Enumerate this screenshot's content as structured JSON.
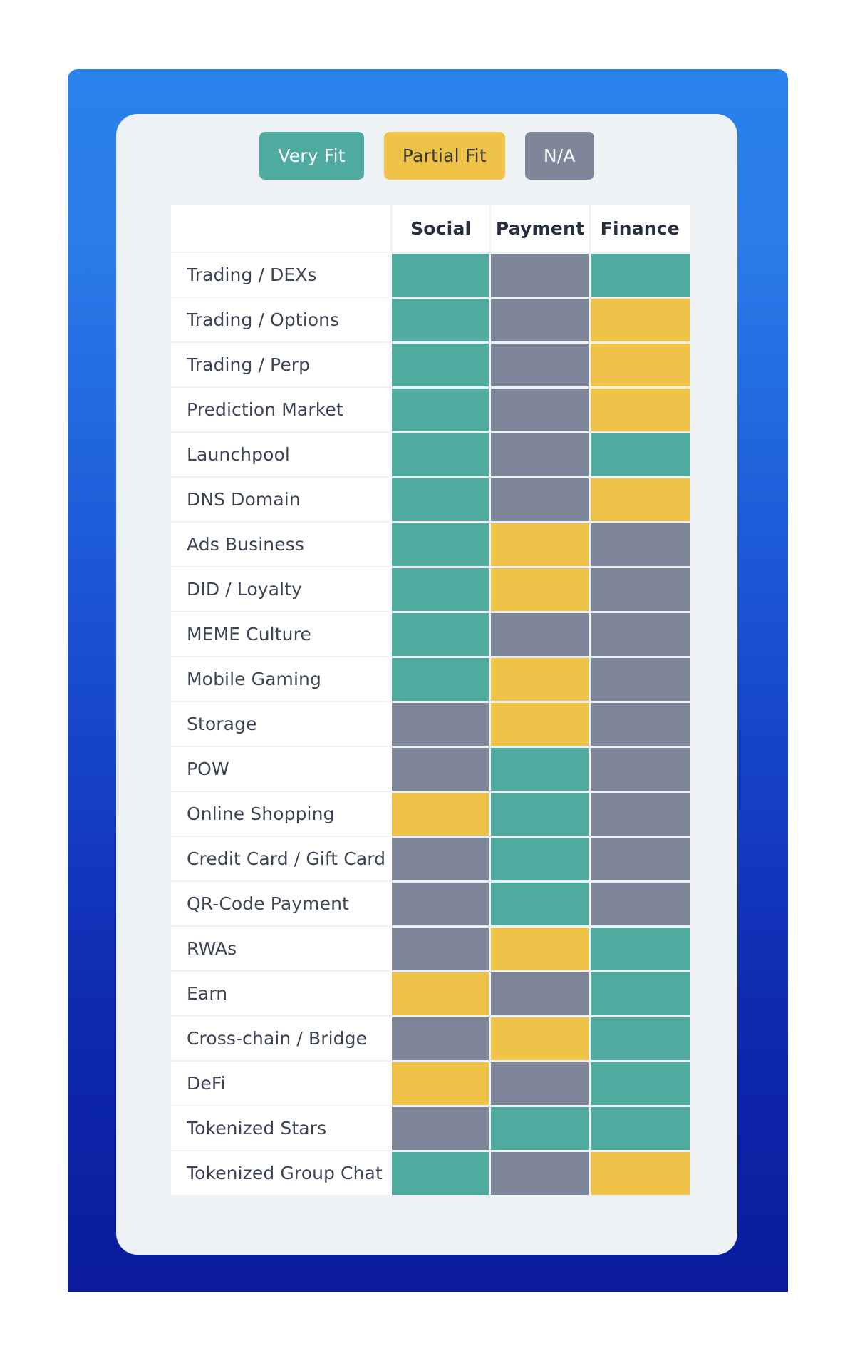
{
  "legend": {
    "items": [
      {
        "label": "Very Fit",
        "key": "very",
        "color": "#4fab9f"
      },
      {
        "label": "Partial Fit",
        "key": "partial",
        "color": "#efc348"
      },
      {
        "label": "N/A",
        "key": "na",
        "color": "#7d8799"
      }
    ]
  },
  "chart_data": {
    "type": "heatmap",
    "title": "",
    "xlabel": "",
    "ylabel": "",
    "legend_position": "top-center",
    "corner_header": "",
    "categories": [
      "Social",
      "Payment",
      "Finance"
    ],
    "row_labels": [
      "Trading / DEXs",
      "Trading / Options",
      "Trading / Perp",
      "Prediction Market",
      "Launchpool",
      "DNS Domain",
      "Ads Business",
      "DID / Loyalty",
      "MEME Culture",
      "Mobile Gaming",
      "Storage",
      "POW",
      "Online Shopping",
      "Credit Card / Gift Card",
      "QR-Code Payment",
      "RWAs",
      "Earn",
      "Cross-chain / Bridge",
      "DeFi",
      "Tokenized Stars",
      "Tokenized Group Chat"
    ],
    "value_levels": {
      "very": "Very Fit",
      "partial": "Partial Fit",
      "na": "N/A"
    },
    "values": [
      [
        "very",
        "na",
        "very"
      ],
      [
        "very",
        "na",
        "partial"
      ],
      [
        "very",
        "na",
        "partial"
      ],
      [
        "very",
        "na",
        "partial"
      ],
      [
        "very",
        "na",
        "very"
      ],
      [
        "very",
        "na",
        "partial"
      ],
      [
        "very",
        "partial",
        "na"
      ],
      [
        "very",
        "partial",
        "na"
      ],
      [
        "very",
        "na",
        "na"
      ],
      [
        "very",
        "partial",
        "na"
      ],
      [
        "na",
        "partial",
        "na"
      ],
      [
        "na",
        "very",
        "na"
      ],
      [
        "partial",
        "very",
        "na"
      ],
      [
        "na",
        "very",
        "na"
      ],
      [
        "na",
        "very",
        "na"
      ],
      [
        "na",
        "partial",
        "very"
      ],
      [
        "partial",
        "na",
        "very"
      ],
      [
        "na",
        "partial",
        "very"
      ],
      [
        "partial",
        "na",
        "very"
      ],
      [
        "na",
        "very",
        "very"
      ],
      [
        "very",
        "na",
        "partial"
      ]
    ]
  }
}
